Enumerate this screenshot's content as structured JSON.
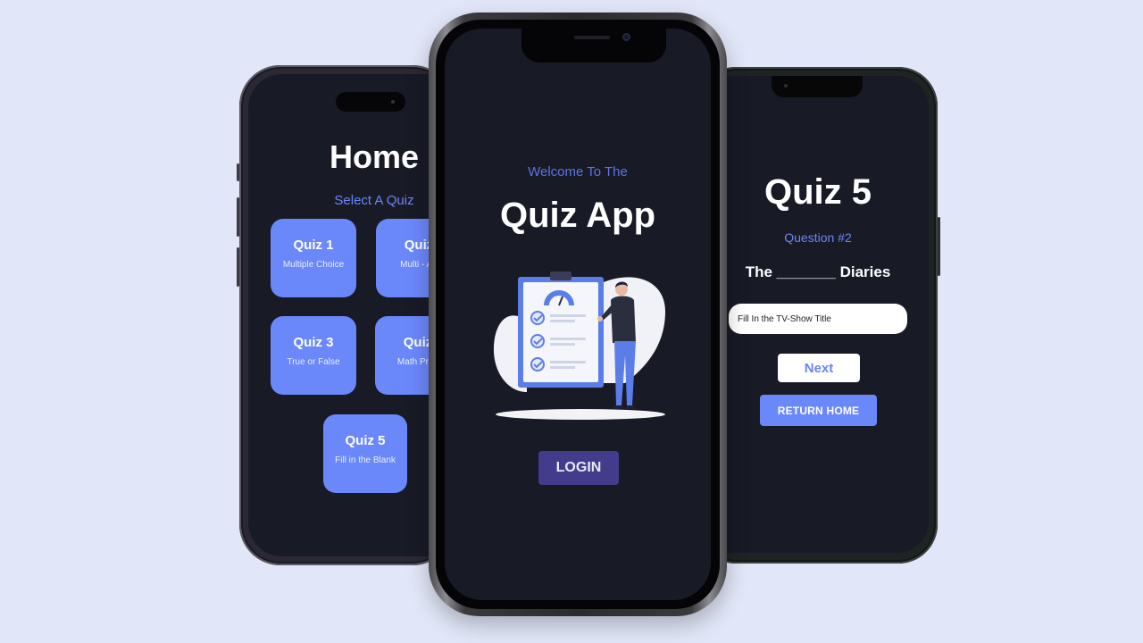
{
  "home_screen": {
    "title": "Home",
    "subtitle": "Select A Quiz",
    "quizzes": [
      {
        "title": "Quiz 1",
        "subtitle": "Multiple Choice"
      },
      {
        "title": "Quiz",
        "subtitle": "Multi - An"
      },
      {
        "title": "Quiz 3",
        "subtitle": "True or False"
      },
      {
        "title": "Quiz",
        "subtitle": "Math Prob"
      },
      {
        "title": "Quiz 5",
        "subtitle": "Fill in the Blank"
      }
    ]
  },
  "login_screen": {
    "welcome": "Welcome To The",
    "title": "Quiz App",
    "login_label": "LOGIN",
    "illustration_icon": "clipboard-checklist-person"
  },
  "quiz_screen": {
    "title": "Quiz 5",
    "question_number": "Question #2",
    "prompt": "The _______ Diaries",
    "answer_placeholder": "Fill In the TV-Show Title",
    "next_label": "Next",
    "return_label": "RETURN HOME"
  },
  "colors": {
    "background": "#e1e7f8",
    "screen": "#181a26",
    "accent": "#6b88fb",
    "login_button": "#433c8c"
  }
}
